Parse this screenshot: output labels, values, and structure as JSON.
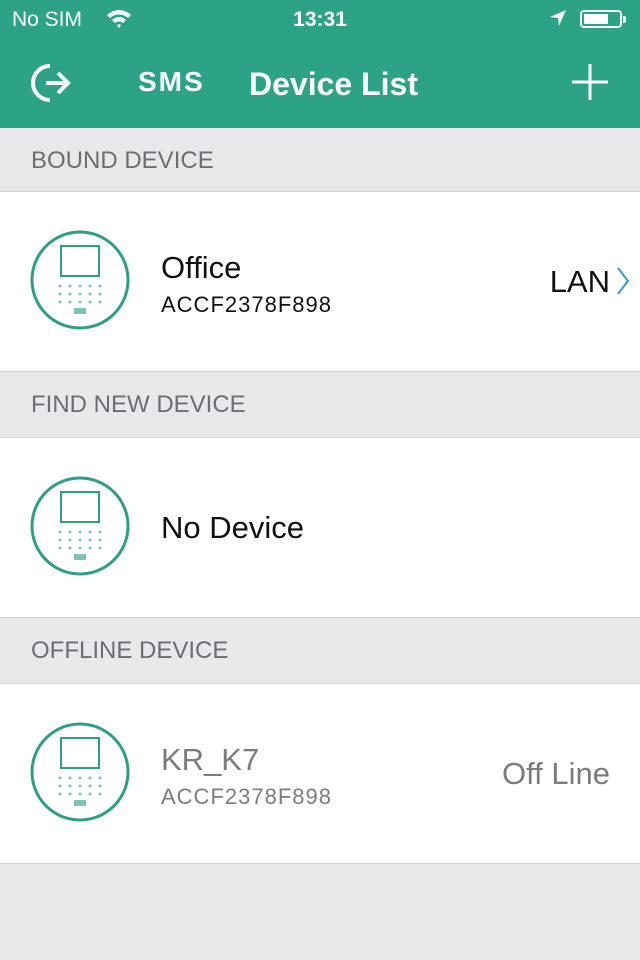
{
  "status_bar": {
    "carrier": "No SIM",
    "time": "13:31"
  },
  "nav": {
    "sms_label": "SMS",
    "title": "Device List"
  },
  "sections": [
    {
      "header": "BOUND DEVICE",
      "device": {
        "name": "Office",
        "mac": "ACCF2378F898",
        "status": "LAN"
      }
    },
    {
      "header": "FIND NEW DEVICE",
      "device": {
        "name": "No Device"
      }
    },
    {
      "header": "OFFLINE DEVICE",
      "device": {
        "name": "KR_K7",
        "mac": "ACCF2378F898",
        "status": "Off Line"
      }
    }
  ],
  "colors": {
    "accent": "#2ca287",
    "chevron": "#3a9ad9"
  }
}
